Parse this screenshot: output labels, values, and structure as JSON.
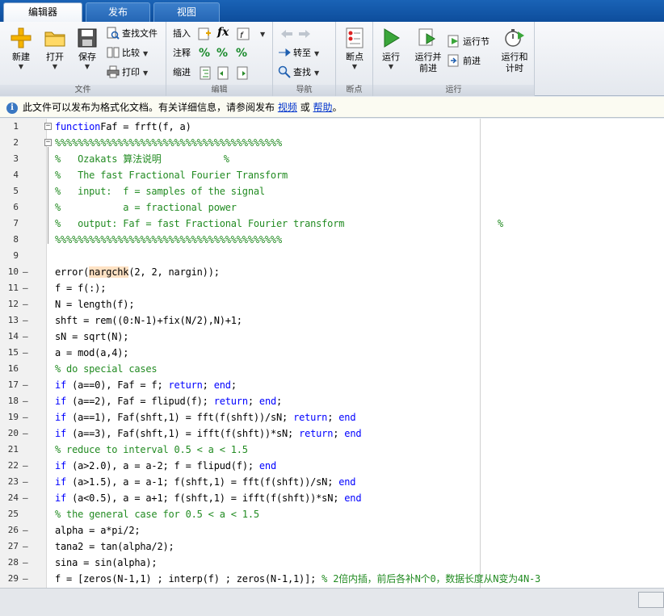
{
  "tabs": [
    {
      "label": "编辑器",
      "active": true
    },
    {
      "label": "发布",
      "active": false
    },
    {
      "label": "视图",
      "active": false
    }
  ],
  "ribbon": {
    "file": {
      "group_label": "文件",
      "new": "新建",
      "open": "打开",
      "save": "保存",
      "find_files": "查找文件",
      "compare": "比较",
      "print": "打印"
    },
    "edit": {
      "group_label": "编辑",
      "insert": "插入",
      "comment": "注释",
      "indent": "缩进",
      "fx": "fx"
    },
    "navigate": {
      "group_label": "导航",
      "goto": "转至",
      "find": "查找"
    },
    "breakpoints": {
      "group_label": "断点",
      "breakpoints": "断点"
    },
    "run": {
      "group_label": "运行",
      "run": "运行",
      "run_advance": "运行并\n前进",
      "run_section": "运行节",
      "advance": "前进",
      "run_time": "运行和\n计时"
    }
  },
  "infobar": {
    "text": "此文件可以发布为格式化文档。有关详细信息，请参阅发布",
    "link_video": "视频",
    "or": "或",
    "link_help": "帮助",
    "end": "。"
  },
  "colors": {
    "keyword": "#0000ff",
    "comment": "#228b22",
    "highlight": "#ffe2c4"
  },
  "editor": {
    "lines": [
      {
        "n": "1",
        "bp": "",
        "fold": "−",
        "segs": [
          [
            "kw",
            "function"
          ],
          [
            "",
            "Faf = frft(f, a)"
          ]
        ]
      },
      {
        "n": "2",
        "bp": "",
        "fold": "−",
        "segs": [
          [
            "cm",
            "%%%%%%%%%%%%%%%%%%%%%%%%%%%%%%%%%%%%%%%%"
          ]
        ]
      },
      {
        "n": "3",
        "bp": "",
        "fold": "",
        "segs": [
          [
            "cm",
            "%   Ozakats 算法说明           %"
          ]
        ]
      },
      {
        "n": "4",
        "bp": "",
        "fold": "",
        "segs": [
          [
            "cm",
            "%   The fast Fractional Fourier Transform"
          ]
        ]
      },
      {
        "n": "5",
        "bp": "",
        "fold": "",
        "segs": [
          [
            "cm",
            "%   input:  f = samples of the signal"
          ]
        ]
      },
      {
        "n": "6",
        "bp": "",
        "fold": "",
        "segs": [
          [
            "cm",
            "%           a = fractional power"
          ]
        ]
      },
      {
        "n": "7",
        "bp": "",
        "fold": "",
        "segs": [
          [
            "cm",
            "%   output: Faf = fast Fractional Fourier transform                           %"
          ]
        ]
      },
      {
        "n": "8",
        "bp": "",
        "fold": "",
        "segs": [
          [
            "cm",
            "%%%%%%%%%%%%%%%%%%%%%%%%%%%%%%%%%%%%%%%%"
          ]
        ]
      },
      {
        "n": "9",
        "bp": "",
        "fold": "",
        "segs": []
      },
      {
        "n": "10",
        "bp": "–",
        "fold": "",
        "segs": [
          [
            "",
            "error("
          ],
          [
            "hl",
            "nargchk"
          ],
          [
            "",
            "(2, 2, nargin));"
          ]
        ]
      },
      {
        "n": "11",
        "bp": "–",
        "fold": "",
        "segs": [
          [
            "",
            "f = f(:);"
          ]
        ]
      },
      {
        "n": "12",
        "bp": "–",
        "fold": "",
        "segs": [
          [
            "",
            "N = length(f);"
          ]
        ]
      },
      {
        "n": "13",
        "bp": "–",
        "fold": "",
        "segs": [
          [
            "",
            "shft = rem((0:N-1)+fix(N/2),N)+1;"
          ]
        ]
      },
      {
        "n": "14",
        "bp": "–",
        "fold": "",
        "segs": [
          [
            "",
            "sN = sqrt(N);"
          ]
        ]
      },
      {
        "n": "15",
        "bp": "–",
        "fold": "",
        "segs": [
          [
            "",
            "a = mod(a,4);"
          ]
        ]
      },
      {
        "n": "16",
        "bp": "",
        "fold": "",
        "segs": [
          [
            "cm",
            "% do special cases"
          ]
        ]
      },
      {
        "n": "17",
        "bp": "–",
        "fold": "",
        "segs": [
          [
            "kw",
            "if"
          ],
          [
            "",
            " (a==0), Faf = f; "
          ],
          [
            "kw",
            "return"
          ],
          [
            "",
            "; "
          ],
          [
            "kw",
            "end"
          ],
          [
            "",
            ";"
          ]
        ]
      },
      {
        "n": "18",
        "bp": "–",
        "fold": "",
        "segs": [
          [
            "kw",
            "if"
          ],
          [
            "",
            " (a==2), Faf = flipud(f); "
          ],
          [
            "kw",
            "return"
          ],
          [
            "",
            "; "
          ],
          [
            "kw",
            "end"
          ],
          [
            "",
            ";"
          ]
        ]
      },
      {
        "n": "19",
        "bp": "–",
        "fold": "",
        "segs": [
          [
            "kw",
            "if"
          ],
          [
            "",
            " (a==1), Faf(shft,1) = fft(f(shft))/sN; "
          ],
          [
            "kw",
            "return"
          ],
          [
            "",
            "; "
          ],
          [
            "kw",
            "end"
          ]
        ]
      },
      {
        "n": "20",
        "bp": "–",
        "fold": "",
        "segs": [
          [
            "kw",
            "if"
          ],
          [
            "",
            " (a==3), Faf(shft,1) = ifft(f(shft))*sN; "
          ],
          [
            "kw",
            "return"
          ],
          [
            "",
            "; "
          ],
          [
            "kw",
            "end"
          ]
        ]
      },
      {
        "n": "21",
        "bp": "",
        "fold": "",
        "segs": [
          [
            "cm",
            "% reduce to interval 0.5 < a < 1.5"
          ]
        ]
      },
      {
        "n": "22",
        "bp": "–",
        "fold": "",
        "segs": [
          [
            "kw",
            "if"
          ],
          [
            "",
            " (a>2.0), a = a-2; f = flipud(f); "
          ],
          [
            "kw",
            "end"
          ]
        ]
      },
      {
        "n": "23",
        "bp": "–",
        "fold": "",
        "segs": [
          [
            "kw",
            "if"
          ],
          [
            "",
            " (a>1.5), a = a-1; f(shft,1) = fft(f(shft))/sN; "
          ],
          [
            "kw",
            "end"
          ]
        ]
      },
      {
        "n": "24",
        "bp": "–",
        "fold": "",
        "segs": [
          [
            "kw",
            "if"
          ],
          [
            "",
            " (a<0.5), a = a+1; f(shft,1) = ifft(f(shft))*sN; "
          ],
          [
            "kw",
            "end"
          ]
        ]
      },
      {
        "n": "25",
        "bp": "",
        "fold": "",
        "segs": [
          [
            "cm",
            "% the general case for 0.5 < a < 1.5"
          ]
        ]
      },
      {
        "n": "26",
        "bp": "–",
        "fold": "",
        "segs": [
          [
            "",
            "alpha = a*pi/2;"
          ]
        ]
      },
      {
        "n": "27",
        "bp": "–",
        "fold": "",
        "segs": [
          [
            "",
            "tana2 = tan(alpha/2);"
          ]
        ]
      },
      {
        "n": "28",
        "bp": "–",
        "fold": "",
        "segs": [
          [
            "",
            "sina = sin(alpha);"
          ]
        ]
      },
      {
        "n": "29",
        "bp": "–",
        "fold": "",
        "segs": [
          [
            "",
            "f = [zeros(N-1,1) ; interp(f) ; zeros(N-1,1)]; "
          ],
          [
            "cm",
            "% 2倍内插，前后各补N个0，数据长度从N变为4N-3"
          ]
        ]
      }
    ]
  }
}
